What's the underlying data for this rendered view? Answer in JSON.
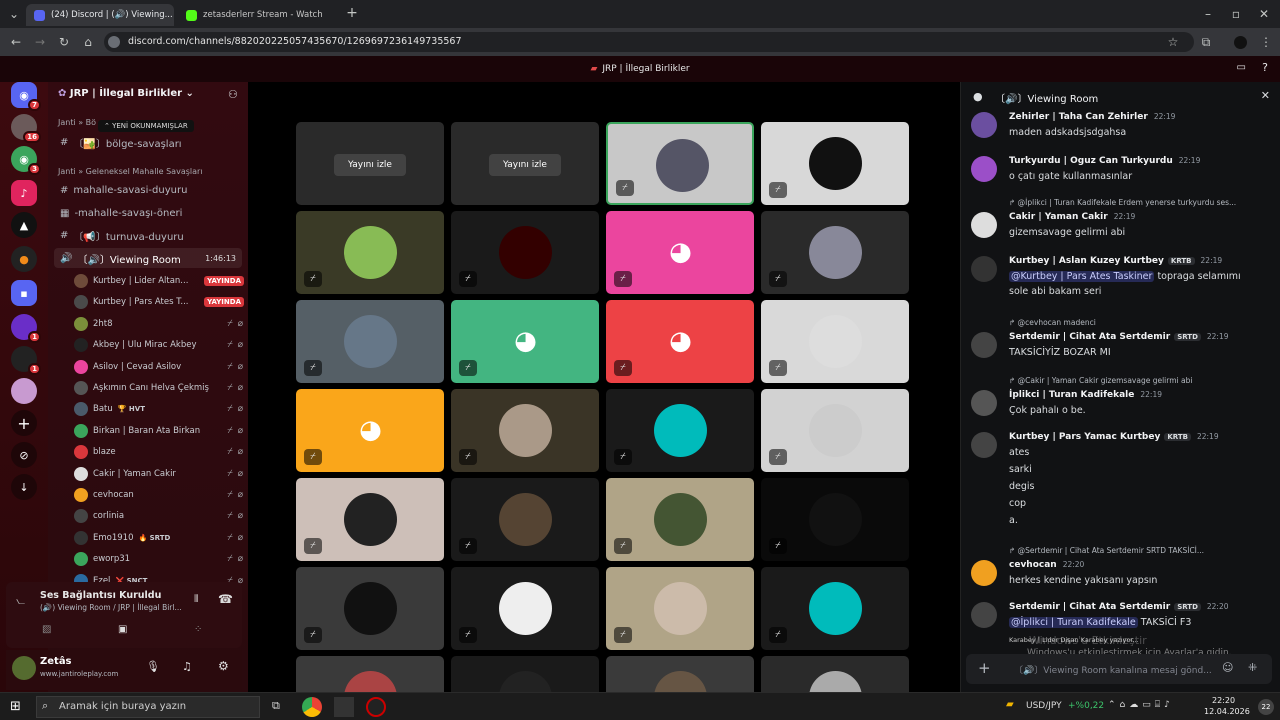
{
  "browser": {
    "tabs": [
      {
        "label": "(24) Discord | (🔊) Viewing...",
        "active": true
      },
      {
        "label": "zetasderlerr Stream - Watch Li...",
        "active": false
      }
    ],
    "new_tab": "+",
    "url": "discord.com/channels/882020225057435670/1269697236149735567"
  },
  "discord": {
    "window_title": "JRP | İllegal Birlikler",
    "server_name": "JRP | İllegal Birlikler",
    "rail_badges": [
      "7",
      "16",
      "3",
      "1",
      "1"
    ],
    "new_unread": "YENİ OKUNMAMIŞLAR",
    "categories": [
      "Janti » Bö",
      "Janti » Geleneksel Mahalle Savaşları"
    ],
    "channels": [
      {
        "prefix": "#",
        "name": "〔🏜️〕bölge-savaşları"
      },
      {
        "prefix": "#",
        "name": "mahalle-savasi-duyuru"
      },
      {
        "prefix": "#",
        "name": "-mahalle-savaşı-öneri"
      },
      {
        "prefix": "#",
        "name": "〔📢〕turnuva-duyuru"
      },
      {
        "prefix": "🔊",
        "name": "〔🔊〕Viewing Room",
        "time": "1:46:13"
      }
    ],
    "voice_users": [
      {
        "name": "Kurtbey | Lider Altan...",
        "live": "YAYINDA",
        "color": "#6e4b3a"
      },
      {
        "name": "Kurtbey | Pars Ates T...",
        "live": "YAYINDA",
        "color": "#4a4a4a"
      },
      {
        "name": "2ht8",
        "color": "#7b8f3a"
      },
      {
        "name": "Akbey | Ulu Mirac Akbey",
        "color": "#222"
      },
      {
        "name": "Asilov | Cevad Asilov",
        "color": "#eb459e"
      },
      {
        "name": "Aşkımın Canı Helva Çekmiş",
        "color": "#555"
      },
      {
        "name": "Batu",
        "tag": "🏆 HVT",
        "color": "#4a5a6a"
      },
      {
        "name": "Birkan | Baran Ata Birkan",
        "color": "#3ba55c"
      },
      {
        "name": "blaze",
        "color": "#da373c"
      },
      {
        "name": "Cakir | Yaman Cakir",
        "color": "#ddd"
      },
      {
        "name": "cevhocan",
        "color": "#f0a020"
      },
      {
        "name": "corlinia",
        "color": "#444"
      },
      {
        "name": "Emo1910",
        "tag": "🔥 SRTD",
        "color": "#333"
      },
      {
        "name": "eworp31",
        "color": "#3ba55c"
      },
      {
        "name": "Ezel",
        "tag": "❌ SNCT",
        "color": "#2a6aa0"
      }
    ],
    "voice_panel": {
      "status": "Ses Bağlantısı Kuruldu",
      "location": "(🔊) Viewing Room / JRP | İllegal Birl..."
    },
    "user_panel": {
      "name": "Zetâs",
      "status": "www.jantiroleplay.com"
    },
    "stage": {
      "watch_label": "Yayını izle"
    },
    "chat": {
      "title": "〔🔊〕Viewing Room",
      "messages": [
        {
          "author": "Zehirler | Taha Can Zehirler",
          "time": "22:19",
          "lines": [
            "maden adskadsjsdgahsa"
          ],
          "color": "#6b4fa0"
        },
        {
          "author": "Turkyurdu | Oguz Can Turkyurdu",
          "time": "22:19",
          "lines": [
            "o çatı gate kullanmasınlar"
          ],
          "color": "#9b4fc8"
        },
        {
          "reply": "@İplikci | Turan Kadifekale  Erdem yenerse turkyurdu ses...",
          "author": "Cakir | Yaman Cakir",
          "time": "22:19",
          "lines": [
            "gizemsavage gelirmi abi"
          ],
          "color": "#ddd"
        },
        {
          "author": "Kurtbey | Aslan Kuzey Kurtbey",
          "tag": "KRTB",
          "time": "22:19",
          "mention": "@Kurtbey | Pars Ates Taskiner",
          "lines": [
            "topraga selamımı",
            "sole abi bakam seri"
          ],
          "color": "#333"
        },
        {
          "reply": "@cevhocan  madenci",
          "author": "Sertdemir | Cihat Ata Sertdemir",
          "tag": "SRTD",
          "time": "22:19",
          "lines": [
            "TAKSİCİYİZ BOZAR MI"
          ],
          "color": "#444"
        },
        {
          "reply": "@Cakir | Yaman Cakir  gizemsavage gelirmi abi",
          "author": "İplikci | Turan Kadifekale",
          "time": "22:19",
          "lines": [
            "Çok pahalı o be."
          ],
          "color": "#555"
        },
        {
          "author": "Kurtbey | Pars Yamac Kurtbey",
          "tag": "KRTB",
          "time": "22:19",
          "lines": [
            "ates",
            "sarki",
            "degis",
            "cop",
            "a."
          ],
          "color": "#444"
        },
        {
          "reply": "@Sertdemir | Cihat Ata Sertdemir  SRTD  TAKSİCİ...",
          "author": "cevhocan",
          "time": "22:20",
          "lines": [
            "herkes kendine yakısanı yapsın"
          ],
          "color": "#f0a020"
        },
        {
          "author": "Sertdemir | Cihat Ata Sertdemir",
          "tag": "SRTD",
          "time": "22:20",
          "mention": "@İplikci | Turan Kadifekale",
          "lines": [
            "TAKSİCİ F3"
          ],
          "color": "#444"
        }
      ],
      "typing": "Karabey | Lider Dişan Karabey yazıyor...",
      "watermark_1": "Windows'u Etkinleştir",
      "watermark_2": "Windows'u etkinleştirmek için Ayarlar'a gidin.",
      "input_placeholder": "〔🔊〕Viewing Room kanalına mesaj gönd..."
    }
  },
  "taskbar": {
    "search_placeholder": "Aramak için buraya yazın",
    "ticker": "USD/JPY",
    "ticker_change": "+%0,22",
    "time": "22:20",
    "date": "12.04.2026",
    "notif": "22"
  }
}
